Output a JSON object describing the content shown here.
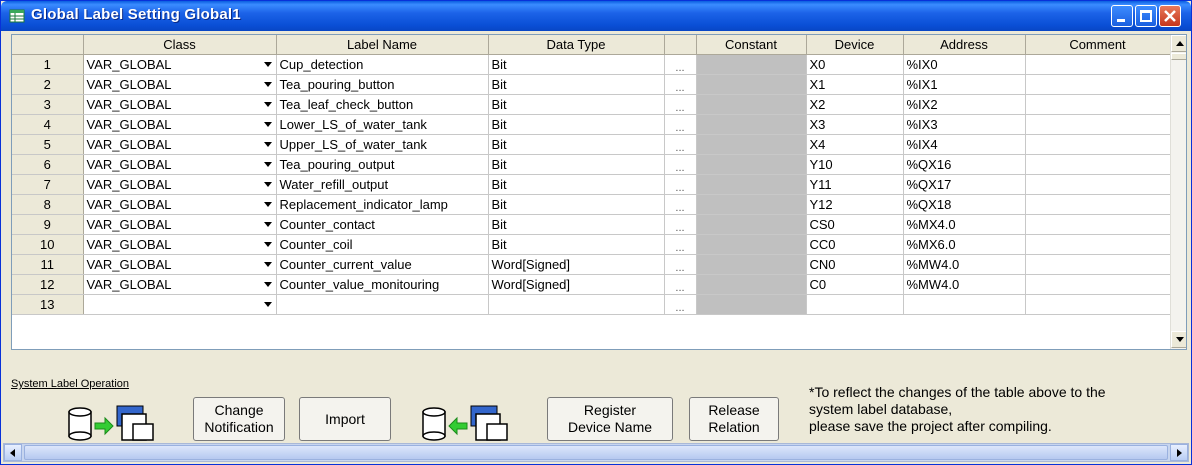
{
  "window": {
    "title": "Global Label Setting Global1"
  },
  "columns": [
    "Class",
    "Label Name",
    "Data Type",
    "Constant",
    "Device",
    "Address",
    "Comment"
  ],
  "rows": [
    {
      "n": "1",
      "cls": "VAR_GLOBAL",
      "label": "Cup_detection",
      "type": "Bit",
      "device": "X0",
      "address": "%IX0"
    },
    {
      "n": "2",
      "cls": "VAR_GLOBAL",
      "label": "Tea_pouring_button",
      "type": "Bit",
      "device": "X1",
      "address": "%IX1"
    },
    {
      "n": "3",
      "cls": "VAR_GLOBAL",
      "label": "Tea_leaf_check_button",
      "type": "Bit",
      "device": "X2",
      "address": "%IX2"
    },
    {
      "n": "4",
      "cls": "VAR_GLOBAL",
      "label": "Lower_LS_of_water_tank",
      "type": "Bit",
      "device": "X3",
      "address": "%IX3"
    },
    {
      "n": "5",
      "cls": "VAR_GLOBAL",
      "label": "Upper_LS_of_water_tank",
      "type": "Bit",
      "device": "X4",
      "address": "%IX4"
    },
    {
      "n": "6",
      "cls": "VAR_GLOBAL",
      "label": "Tea_pouring_output",
      "type": "Bit",
      "device": "Y10",
      "address": "%QX16"
    },
    {
      "n": "7",
      "cls": "VAR_GLOBAL",
      "label": "Water_refill_output",
      "type": "Bit",
      "device": "Y11",
      "address": "%QX17"
    },
    {
      "n": "8",
      "cls": "VAR_GLOBAL",
      "label": "Replacement_indicator_lamp",
      "type": "Bit",
      "device": "Y12",
      "address": "%QX18"
    },
    {
      "n": "9",
      "cls": "VAR_GLOBAL",
      "label": "Counter_contact",
      "type": "Bit",
      "device": "CS0",
      "address": "%MX4.0"
    },
    {
      "n": "10",
      "cls": "VAR_GLOBAL",
      "label": "Counter_coil",
      "type": "Bit",
      "device": "CC0",
      "address": "%MX6.0"
    },
    {
      "n": "11",
      "cls": "VAR_GLOBAL",
      "label": "Counter_current_value",
      "type": "Word[Signed]",
      "device": "CN0",
      "address": "%MW4.0"
    },
    {
      "n": "12",
      "cls": "VAR_GLOBAL",
      "label": "Counter_value_monitouring",
      "type": "Word[Signed]",
      "device": "C0",
      "address": "%MW4.0"
    },
    {
      "n": "13",
      "cls": "",
      "label": "",
      "type": "",
      "device": "",
      "address": ""
    }
  ],
  "ellipsis": "...",
  "system_label": "System Label Operation",
  "buttons": {
    "change_notification_1": "Change",
    "change_notification_2": "Notification",
    "import": "Import",
    "register_1": "Register",
    "register_2": "Device Name",
    "release_1": "Release",
    "release_2": "Relation"
  },
  "note": {
    "line1": "*To reflect the changes of the table above to the",
    "line2": "system label database,",
    "line3": "please save the project after compiling."
  },
  "colors": {
    "title_bar": "#0a4fd6",
    "constant_cell": "#c0c0c0",
    "window_bg": "#ece9d8"
  }
}
